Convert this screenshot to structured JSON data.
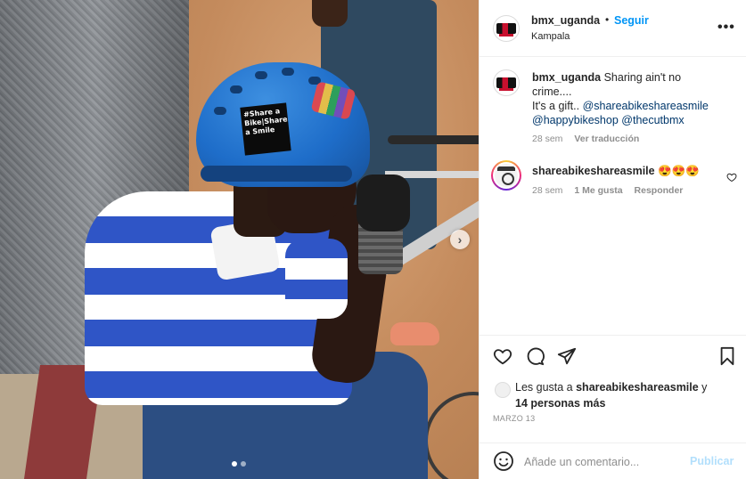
{
  "post": {
    "username": "bmx_uganda",
    "bullet": "•",
    "follow_label": "Seguir",
    "location": "Kampala",
    "more_label": "•••"
  },
  "photo": {
    "sticker_text": "#Share a Bike|Share a Smile",
    "carousel_count": 2,
    "carousel_active_index": 0,
    "next_label": "›"
  },
  "caption": {
    "username": "bmx_uganda",
    "text_line1": "Sharing ain't no crime....",
    "text_line2": "It's a gift..",
    "mentions": [
      "@shareabikeshareasmile",
      "@happybikeshop",
      "@thecutbmx"
    ],
    "age": "28 sem",
    "translate_label": "Ver traducción"
  },
  "comment": {
    "username": "shareabikeshareasmile",
    "text": "😍😍😍",
    "age": "28 sem",
    "likes_label": "1 Me gusta",
    "reply_label": "Responder"
  },
  "actions": {
    "likes_prefix": "Les gusta a ",
    "likes_user": "shareabikeshareasmile",
    "likes_and": " y",
    "likes_others": "14 personas más",
    "date": "MARZO 13",
    "comment_placeholder": "Añade un comentario...",
    "post_label": "Publicar"
  },
  "colors": {
    "accent": "#0095f6",
    "mention": "#00376b",
    "muted": "#8e8e8e",
    "post_disabled": "#b2dffc"
  }
}
